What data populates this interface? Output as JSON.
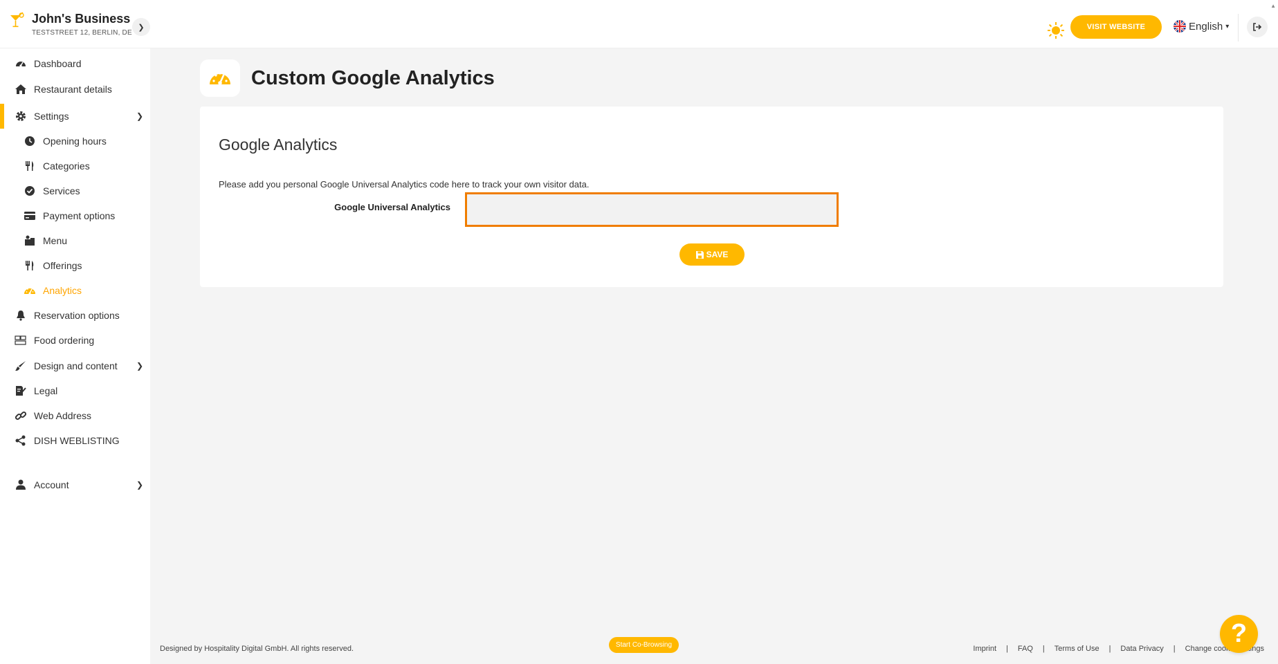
{
  "header": {
    "business_name": "John's Business",
    "business_address": "TESTSTREET 12, BERLIN, DE",
    "visit_website_label": "VISIT WEBSITE",
    "language": "English"
  },
  "sidebar": {
    "items": [
      {
        "label": "Dashboard",
        "icon": "dashboard-icon"
      },
      {
        "label": "Restaurant details",
        "icon": "home-icon"
      },
      {
        "label": "Settings",
        "icon": "gear-icon",
        "expanded": true
      },
      {
        "label": "Opening hours",
        "icon": "clock-icon"
      },
      {
        "label": "Categories",
        "icon": "utensils-icon"
      },
      {
        "label": "Services",
        "icon": "check-circle-icon"
      },
      {
        "label": "Payment options",
        "icon": "credit-card-icon"
      },
      {
        "label": "Menu",
        "icon": "menu-icon"
      },
      {
        "label": "Offerings",
        "icon": "utensils-icon"
      },
      {
        "label": "Analytics",
        "icon": "speedometer-icon",
        "active": true
      },
      {
        "label": "Reservation options",
        "icon": "bell-icon"
      },
      {
        "label": "Food ordering",
        "icon": "food-ordering-icon"
      },
      {
        "label": "Design and content",
        "icon": "brush-icon"
      },
      {
        "label": "Legal",
        "icon": "legal-icon"
      },
      {
        "label": "Web Address",
        "icon": "link-icon"
      },
      {
        "label": "DISH WEBLISTING",
        "icon": "share-icon"
      },
      {
        "label": "Account",
        "icon": "user-icon"
      }
    ]
  },
  "main": {
    "page_title": "Custom Google Analytics",
    "card_title": "Google Analytics",
    "description": "Please add you personal Google Universal Analytics code here to track your own visitor data.",
    "field_label": "Google Universal Analytics",
    "field_value": "",
    "save_label": "SAVE"
  },
  "footer": {
    "copyright": "Designed by Hospitality Digital GmbH. All rights reserved.",
    "cobrowse_label": "Start Co-Browsing",
    "links": [
      "Imprint",
      "FAQ",
      "Terms of Use",
      "Data Privacy",
      "Change cookie settings"
    ]
  },
  "colors": {
    "accent": "#ffb800",
    "active_text": "#ffa500",
    "highlight_border": "#f07d00"
  }
}
